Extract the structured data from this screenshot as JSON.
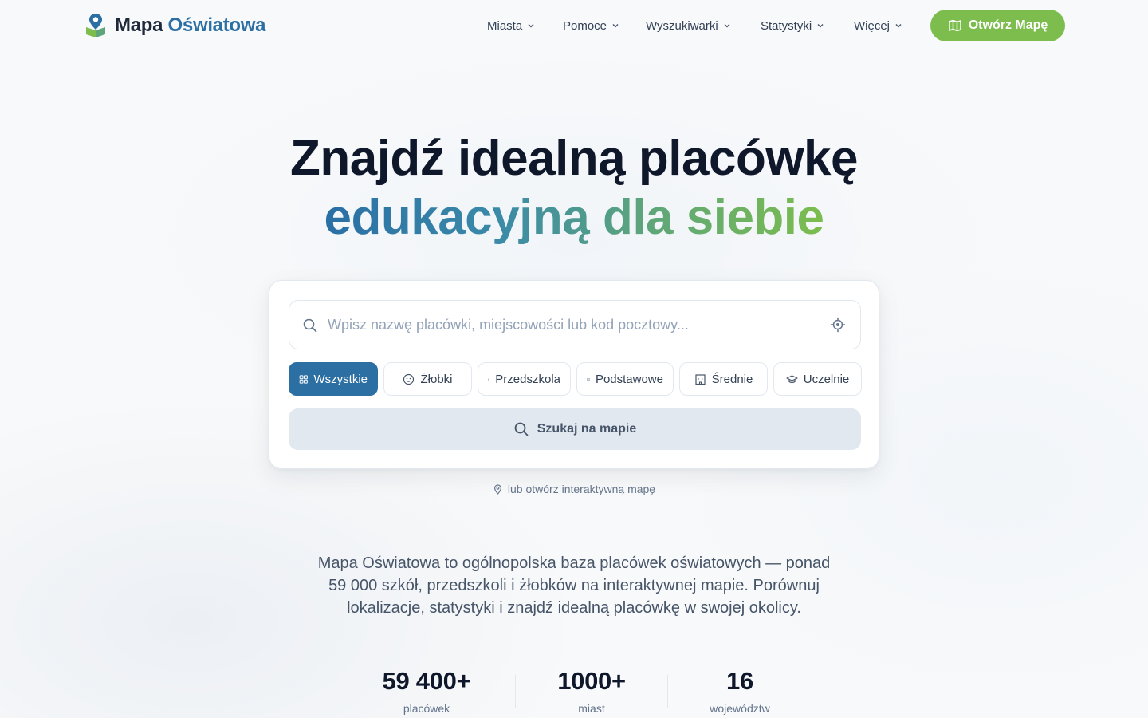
{
  "brand": {
    "name_part1": "Mapa",
    "name_part2": "Oświatowa",
    "icon": "map-pin-book-icon"
  },
  "nav": {
    "items": [
      {
        "label": "Miasta"
      },
      {
        "label": "Pomoce"
      },
      {
        "label": "Wyszukiwarki"
      },
      {
        "label": "Statystyki"
      },
      {
        "label": "Więcej"
      }
    ],
    "cta_label": "Otwórz Mapę"
  },
  "hero": {
    "line1": "Znajdź idealną placówkę",
    "line2": "edukacyjną dla siebie"
  },
  "search": {
    "placeholder": "Wpisz nazwę placówki, miejscowości lub kod pocztowy...",
    "value": "",
    "filters": [
      {
        "label": "Wszystkie",
        "icon": "grid-icon",
        "active": true
      },
      {
        "label": "Żłobki",
        "icon": "baby-icon",
        "active": false
      },
      {
        "label": "Przedszkola",
        "icon": "blocks-icon",
        "active": false
      },
      {
        "label": "Podstawowe",
        "icon": "book-open-icon",
        "active": false
      },
      {
        "label": "Średnie",
        "icon": "building-icon",
        "active": false
      },
      {
        "label": "Uczelnie",
        "icon": "graduation-cap-icon",
        "active": false
      }
    ],
    "button_label": "Szukaj na mapie",
    "map_link": "lub otwórz interaktywną mapę"
  },
  "description": "Mapa Oświatowa to ogólnopolska baza placówek oświatowych — ponad 59 000 szkół, przedszkoli i żłobków na interaktywnej mapie. Porównuj lokalizacje, statystyki i znajdź idealną placówkę w swojej okolicy.",
  "stats": [
    {
      "value": "59 400+",
      "label": "placówek"
    },
    {
      "value": "1000+",
      "label": "miast"
    },
    {
      "value": "16",
      "label": "województw"
    }
  ],
  "colors": {
    "primary_blue": "#2c6fa3",
    "accent_green": "#7cbd4d",
    "text_dark": "#0f172a"
  }
}
